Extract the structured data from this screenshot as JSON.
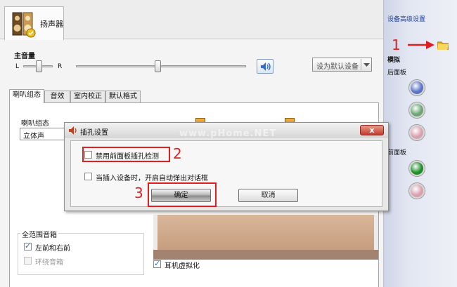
{
  "device_tab": {
    "label": "扬声器",
    "icon": "speaker-icon"
  },
  "volume": {
    "title": "主音量",
    "left": "L",
    "right": "R",
    "default_device_label": "设为默认设备",
    "level_fraction": 0.48,
    "balance_fraction": 0.5
  },
  "subtabs": [
    "喇叭组态",
    "音效",
    "室内校正",
    "默认格式"
  ],
  "speaker_config": {
    "label": "喇叭组态",
    "value": "立体声"
  },
  "full_range": {
    "title": "全范围音箱",
    "front_lr": "左前和右前",
    "surround": "环绕音箱"
  },
  "headphone_virtualization": "耳机虚拟化",
  "sidebar": {
    "advanced_link": "设备高级设置",
    "analog": "模拟",
    "rear_panel": "后面板",
    "front_panel": "前面板",
    "rear_jacks": [
      "#5b72c9",
      "#6ba574",
      "#d9a0b0"
    ],
    "front_jacks": [
      "#1e8f2a",
      "#d9a0b0"
    ]
  },
  "dialog": {
    "title": "插孔设置",
    "close": "x",
    "option_front_panel": "禁用前面板插孔检测",
    "option_auto_popup": "当插入设备时，开启自动弹出对话框",
    "ok": "确定",
    "cancel": "取消"
  },
  "annotations": {
    "one": "1",
    "two": "2",
    "three": "3"
  },
  "watermark": "www.pHome.NET",
  "colors": {
    "annotation_red": "#e02020",
    "accent_blue": "#2c6fd1"
  }
}
